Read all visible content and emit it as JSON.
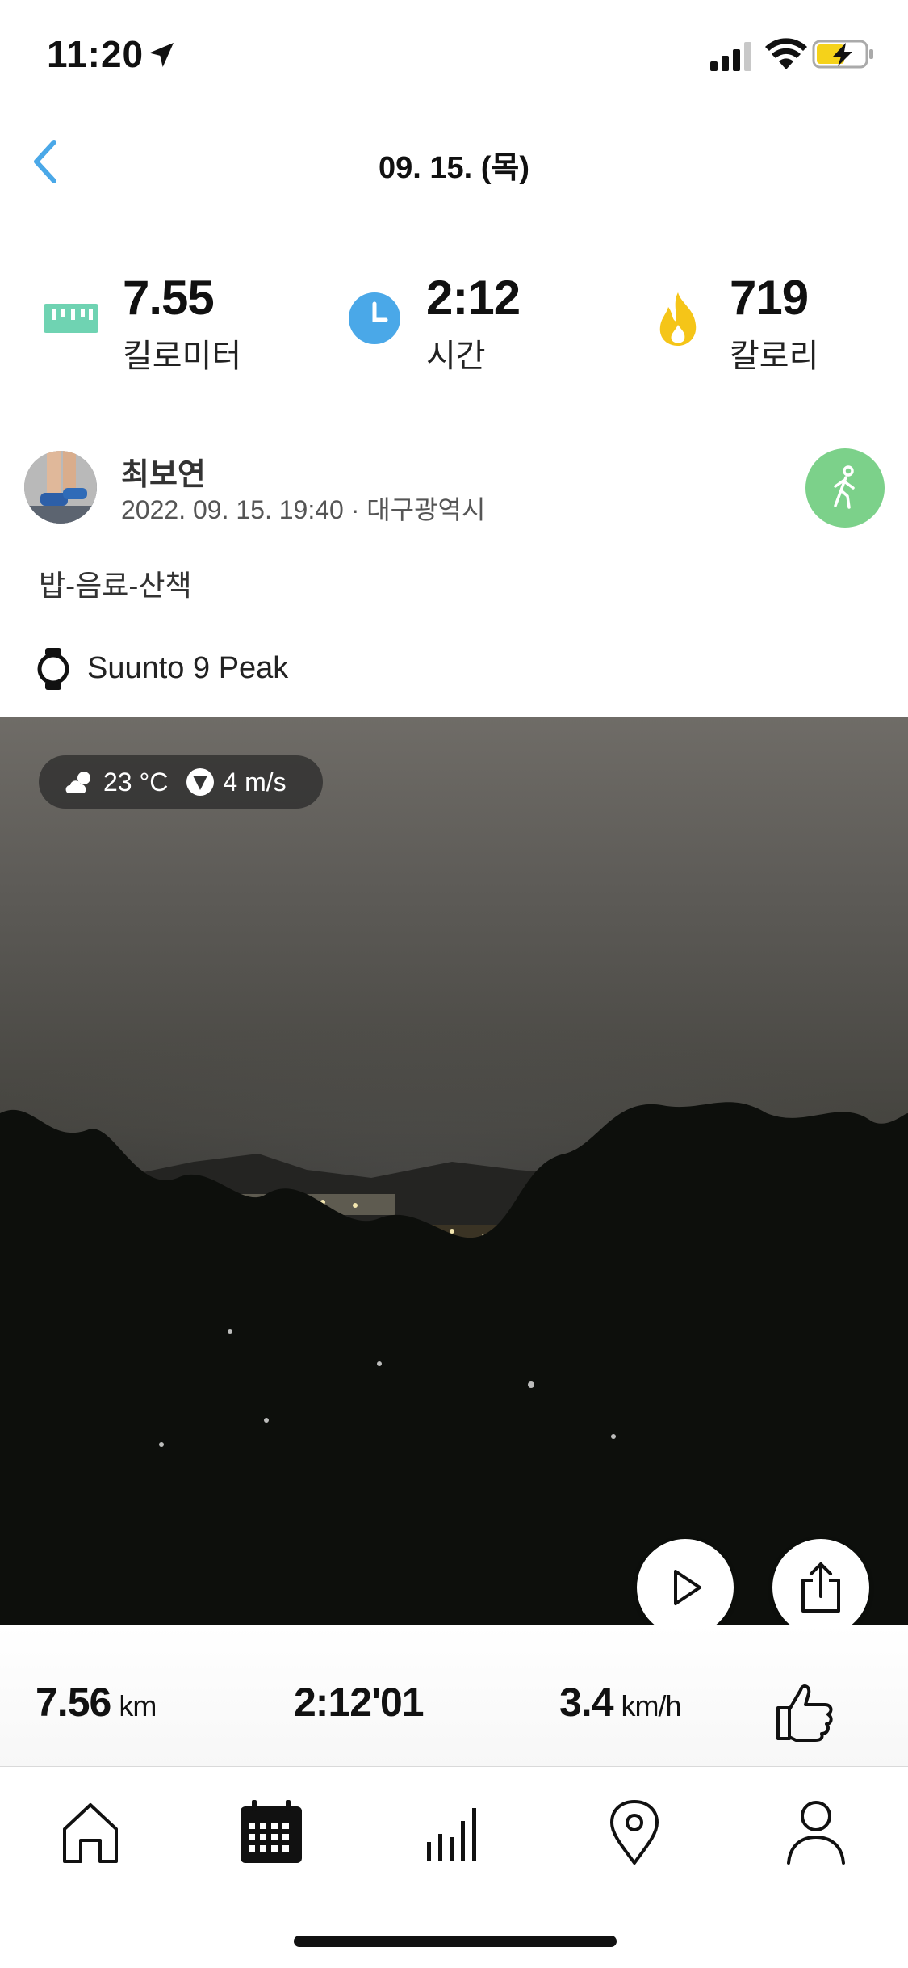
{
  "status_bar": {
    "time": "11:20"
  },
  "header": {
    "title": "09. 15. (목)"
  },
  "summary": {
    "distance_value": "7.55",
    "distance_label": "킬로미터",
    "time_value": "2:12",
    "time_label": "시간",
    "calories_value": "719",
    "calories_label": "칼로리"
  },
  "post": {
    "user_name": "최보연",
    "meta": "2022. 09. 15. 19:40 · 대구광역시",
    "description": "밥-음료-산책",
    "device": "Suunto 9 Peak"
  },
  "weather": {
    "temperature": "23 °C",
    "wind": "4 m/s"
  },
  "bottom_stats": {
    "distance_value": "7.56",
    "distance_unit": "km",
    "duration": "2:12'01",
    "speed_value": "3.4",
    "speed_unit": "km/h"
  },
  "tabs": [
    {
      "icon": "home-icon"
    },
    {
      "icon": "calendar-icon",
      "active": true
    },
    {
      "icon": "bar-chart-icon"
    },
    {
      "icon": "map-pin-icon"
    },
    {
      "icon": "profile-icon"
    }
  ],
  "colors": {
    "accent_blue": "#4aa8e8",
    "distance_green": "#6fd3b2",
    "activity_green": "#7cd18a",
    "flame_yellow": "#f5c518"
  }
}
